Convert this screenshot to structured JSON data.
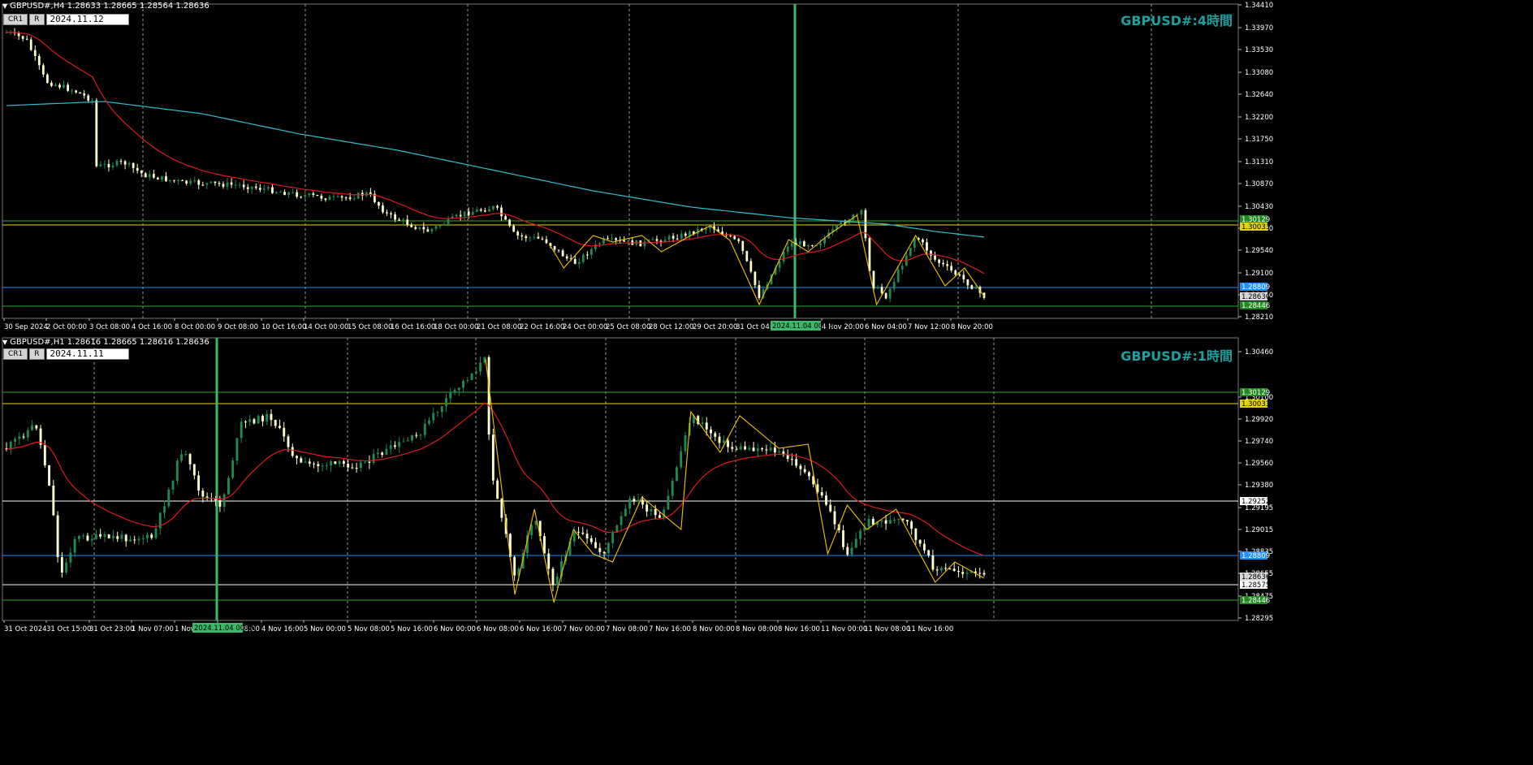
{
  "colors": {
    "bg": "#000000",
    "grid": "#9a9a9a",
    "ma_fast": "#e0191b",
    "ma_slow": "#2dbfd0",
    "zigzag": "#f2c200",
    "bull": "#1f8a52",
    "bear": "#ffffcc",
    "cursor": "#3db86a",
    "title": "#16a2a2",
    "h_green": "#2fa82f",
    "h_yellow": "#e6d300",
    "h_blue": "#1e90ff",
    "h_white": "#ffffff"
  },
  "top": {
    "header": "GBPUSD#,H4  1.28633 1.28665 1.28564 1.28636",
    "btn1": "CR1",
    "btn2": "R",
    "datetime": "2024.11.12 00:00",
    "title": "GBPUSD#:4時間",
    "cursor_label": "2024.11.04 00:00",
    "y_ticks": [
      "1.34410",
      "1.33970",
      "1.33530",
      "1.33080",
      "1.32640",
      "1.32200",
      "1.31750",
      "1.31310",
      "1.30870",
      "1.30430",
      "1.29980",
      "1.29540",
      "1.29100",
      "1.28650",
      "1.28210"
    ],
    "x_ticks": [
      "30 Sep 2024",
      "2 Oct 00:00",
      "3 Oct 08:00",
      "4 Oct 16:00",
      "8 Oct 00:00",
      "9 Oct 08:00",
      "10 Oct 16:00",
      "14 Oct 00:00",
      "15 Oct 08:00",
      "16 Oct 16:00",
      "18 Oct 00:00",
      "21 Oct 08:00",
      "22 Oct 16:00",
      "24 Oct 00:00",
      "25 Oct 08:00",
      "28 Oct 12:00",
      "29 Oct 20:00",
      "31 Oct 04:00",
      "4 Nov 20:00",
      "6 Nov 04:00",
      "7 Nov 12:00",
      "8 Nov 20:00"
    ],
    "price_labels": [
      {
        "text": "1.30129",
        "bg": "#1f8a1f",
        "fg": "#ffffff"
      },
      {
        "text": "1.30033",
        "bg": "#e6d300",
        "fg": "#000000"
      },
      {
        "text": "1.28809",
        "bg": "#1e90ff",
        "fg": "#ffffff"
      },
      {
        "text": "1.28636",
        "bg": "#d8d8d8",
        "fg": "#000000"
      },
      {
        "text": "1.28446",
        "bg": "#1f8a1f",
        "fg": "#ffffff"
      }
    ]
  },
  "bottom": {
    "header": "GBPUSD#,H1  1.28616 1.28665 1.28616 1.28636",
    "btn1": "CR1",
    "btn2": "R",
    "datetime": "2024.11.11 23:00",
    "title": "GBPUSD#:1時間",
    "cursor_label": "2024.11.04 00:00",
    "y_ticks": [
      "1.30460",
      "1.30100",
      "1.29920",
      "1.29740",
      "1.29560",
      "1.29380",
      "1.29195",
      "1.29015",
      "1.28835",
      "1.28655",
      "1.28475",
      "1.28295"
    ],
    "x_ticks": [
      "31 Oct 2024",
      "31 Oct 15:00",
      "31 Oct 23:00",
      "1 Nov 07:00",
      "1 Nov",
      "4 Nov 08:00",
      "4 Nov 16:00",
      "5 Nov 00:00",
      "5 Nov 08:00",
      "5 Nov 16:00",
      "6 Nov 00:00",
      "6 Nov 08:00",
      "6 Nov 16:00",
      "7 Nov 00:00",
      "7 Nov 08:00",
      "7 Nov 16:00",
      "8 Nov 00:00",
      "8 Nov 08:00",
      "8 Nov 16:00",
      "11 Nov 00:00",
      "11 Nov 08:00",
      "11 Nov 16:00"
    ],
    "price_labels": [
      {
        "text": "1.30129",
        "bg": "#1f8a1f",
        "fg": "#ffffff"
      },
      {
        "text": "1.30033",
        "bg": "#e6d300",
        "fg": "#000000"
      },
      {
        "text": "1.29252",
        "bg": "#ffffff",
        "fg": "#000000"
      },
      {
        "text": "1.28809",
        "bg": "#1e90ff",
        "fg": "#ffffff"
      },
      {
        "text": "1.28636",
        "bg": "#d8d8d8",
        "fg": "#000000"
      },
      {
        "text": "1.28575",
        "bg": "#ffffff",
        "fg": "#000000"
      },
      {
        "text": "1.28446",
        "bg": "#1f8a1f",
        "fg": "#ffffff"
      }
    ]
  }
}
